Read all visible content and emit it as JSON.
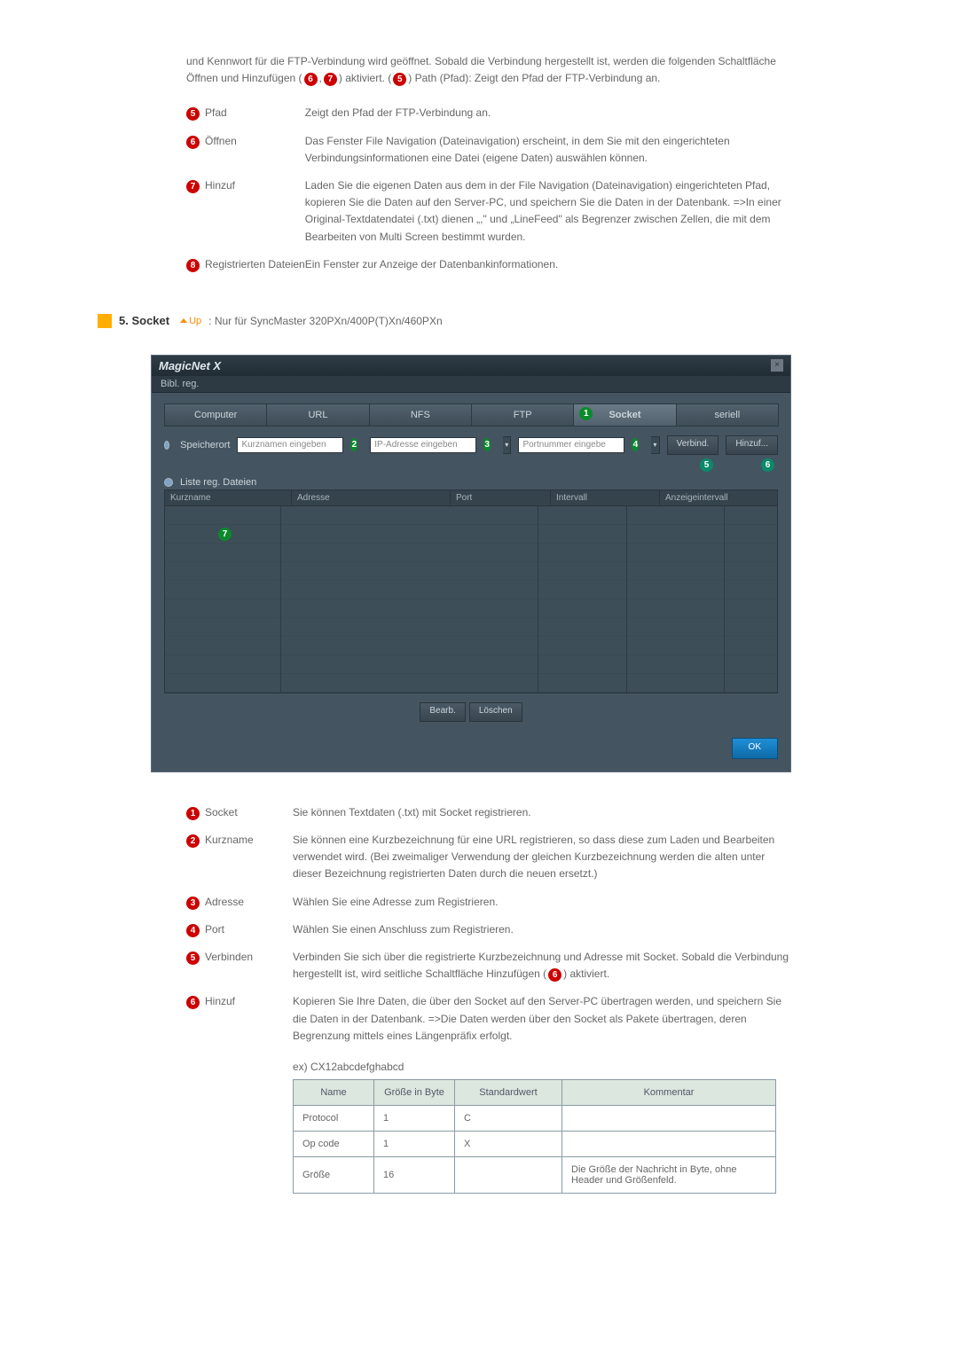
{
  "intro_text": "und Kennwort für die FTP-Verbindung wird geöffnet. Sobald die Verbindung hergestellt ist, werden die folgenden Schaltfläche Öffnen und Hinzufügen (⑥,⑦) aktiviert. (⑤) Path (Pfad): Zeigt den Pfad der FTP-Verbindung an.",
  "ftp_defs": [
    {
      "num": "5",
      "term": "Pfad",
      "desc": "Zeigt den Pfad der FTP-Verbindung an."
    },
    {
      "num": "6",
      "term": "Öffnen",
      "desc": "Das Fenster File Navigation (Dateinavigation) erscheint, in dem Sie mit den eingerichteten Verbindungsinformationen eine Datei (eigene Daten) auswählen können."
    },
    {
      "num": "7",
      "term": "Hinzuf",
      "desc": "Laden Sie die eigenen Daten aus dem in der File Navigation (Dateinavigation) eingerichteten Pfad, kopieren Sie die Daten auf den Server-PC, und speichern Sie die Daten in der Datenbank. =>In einer Original-Textdatendatei (.txt) dienen „,\" und „LineFeed\" als Begrenzer zwischen Zellen, die mit dem Bearbeiten von Multi Screen bestimmt wurden."
    },
    {
      "num": "8",
      "term": "Registrierten Dateien",
      "desc": "Ein Fenster zur Anzeige der Datenbankinformationen."
    }
  ],
  "section": {
    "title": "5. Socket",
    "up": "Up",
    "note": ": Nur für SyncMaster 320PXn/400P(T)Xn/460PXn"
  },
  "app": {
    "logo": "MagicNet X",
    "subtitle": "Bibl. reg.",
    "tabs": [
      "Computer",
      "URL",
      "NFS",
      "FTP",
      "Socket",
      "seriell"
    ],
    "active_tab": 4,
    "tab_badge_num": "1",
    "form": {
      "speicherort": "Speicherort",
      "kurz_ph": "Kurznamen eingeben",
      "kurz_badge": "2",
      "ip_ph": "IP-Adresse eingeben",
      "ip_badge": "3",
      "port_ph": "Portnummer eingebe",
      "port_badge": "4",
      "verbind": "Verbind.",
      "hinzuf": "Hinzuf..."
    },
    "below_badges": [
      "5",
      "6"
    ],
    "list_label": "Liste reg. Dateien",
    "grid_headers": {
      "kurz": "Kurzname",
      "adr": "Adresse",
      "port": "Port",
      "int": "Intervall",
      "anz": "Anzeigeintervall"
    },
    "row_badge": "7",
    "btn_bearb": "Bearb.",
    "btn_loeschen": "Löschen",
    "btn_ok": "OK"
  },
  "socket_defs": [
    {
      "num": "1",
      "term": "Socket",
      "desc": "Sie können Textdaten (.txt) mit Socket registrieren."
    },
    {
      "num": "2",
      "term": "Kurzname",
      "desc": "Sie können eine Kurzbezeichnung für eine URL registrieren, so dass diese zum Laden und Bearbeiten verwendet wird. (Bei zweimaliger Verwendung der gleichen Kurzbezeichnung werden die alten unter dieser Bezeichnung registrierten Daten durch die neuen ersetzt.)"
    },
    {
      "num": "3",
      "term": "Adresse",
      "desc": "Wählen Sie eine Adresse zum Registrieren."
    },
    {
      "num": "4",
      "term": "Port",
      "desc": "Wählen Sie einen Anschluss zum Registrieren."
    },
    {
      "num": "5",
      "term": "Verbinden",
      "desc": "Verbinden Sie sich über die registrierte Kurzbezeichnung und Adresse mit Socket. Sobald die Verbindung hergestellt ist, wird seitliche Schaltfläche Hinzufügen (⑥) aktiviert."
    },
    {
      "num": "6",
      "term": "Hinzuf",
      "desc": "Kopieren Sie Ihre Daten, die über den Socket auf den Server-PC übertragen werden, und speichern Sie die Daten in der Datenbank. =>Die Daten werden über den Socket als Pakete übertragen, deren Begrenzung mittels eines Längenpräfix erfolgt."
    }
  ],
  "example_label": "ex) CX12abcdefghabcd",
  "proto": {
    "headers": {
      "name": "Name",
      "size": "Größe in Byte",
      "std": "Standardwert",
      "kom": "Kommentar"
    },
    "rows": [
      {
        "name": "Protocol",
        "size": "1",
        "std": "C",
        "kom": ""
      },
      {
        "name": "Op code",
        "size": "1",
        "std": "X",
        "kom": ""
      },
      {
        "name": "Größe",
        "size": "16",
        "std": "",
        "kom": "Die Größe der Nachricht in Byte, ohne Header und Größenfeld."
      }
    ]
  }
}
